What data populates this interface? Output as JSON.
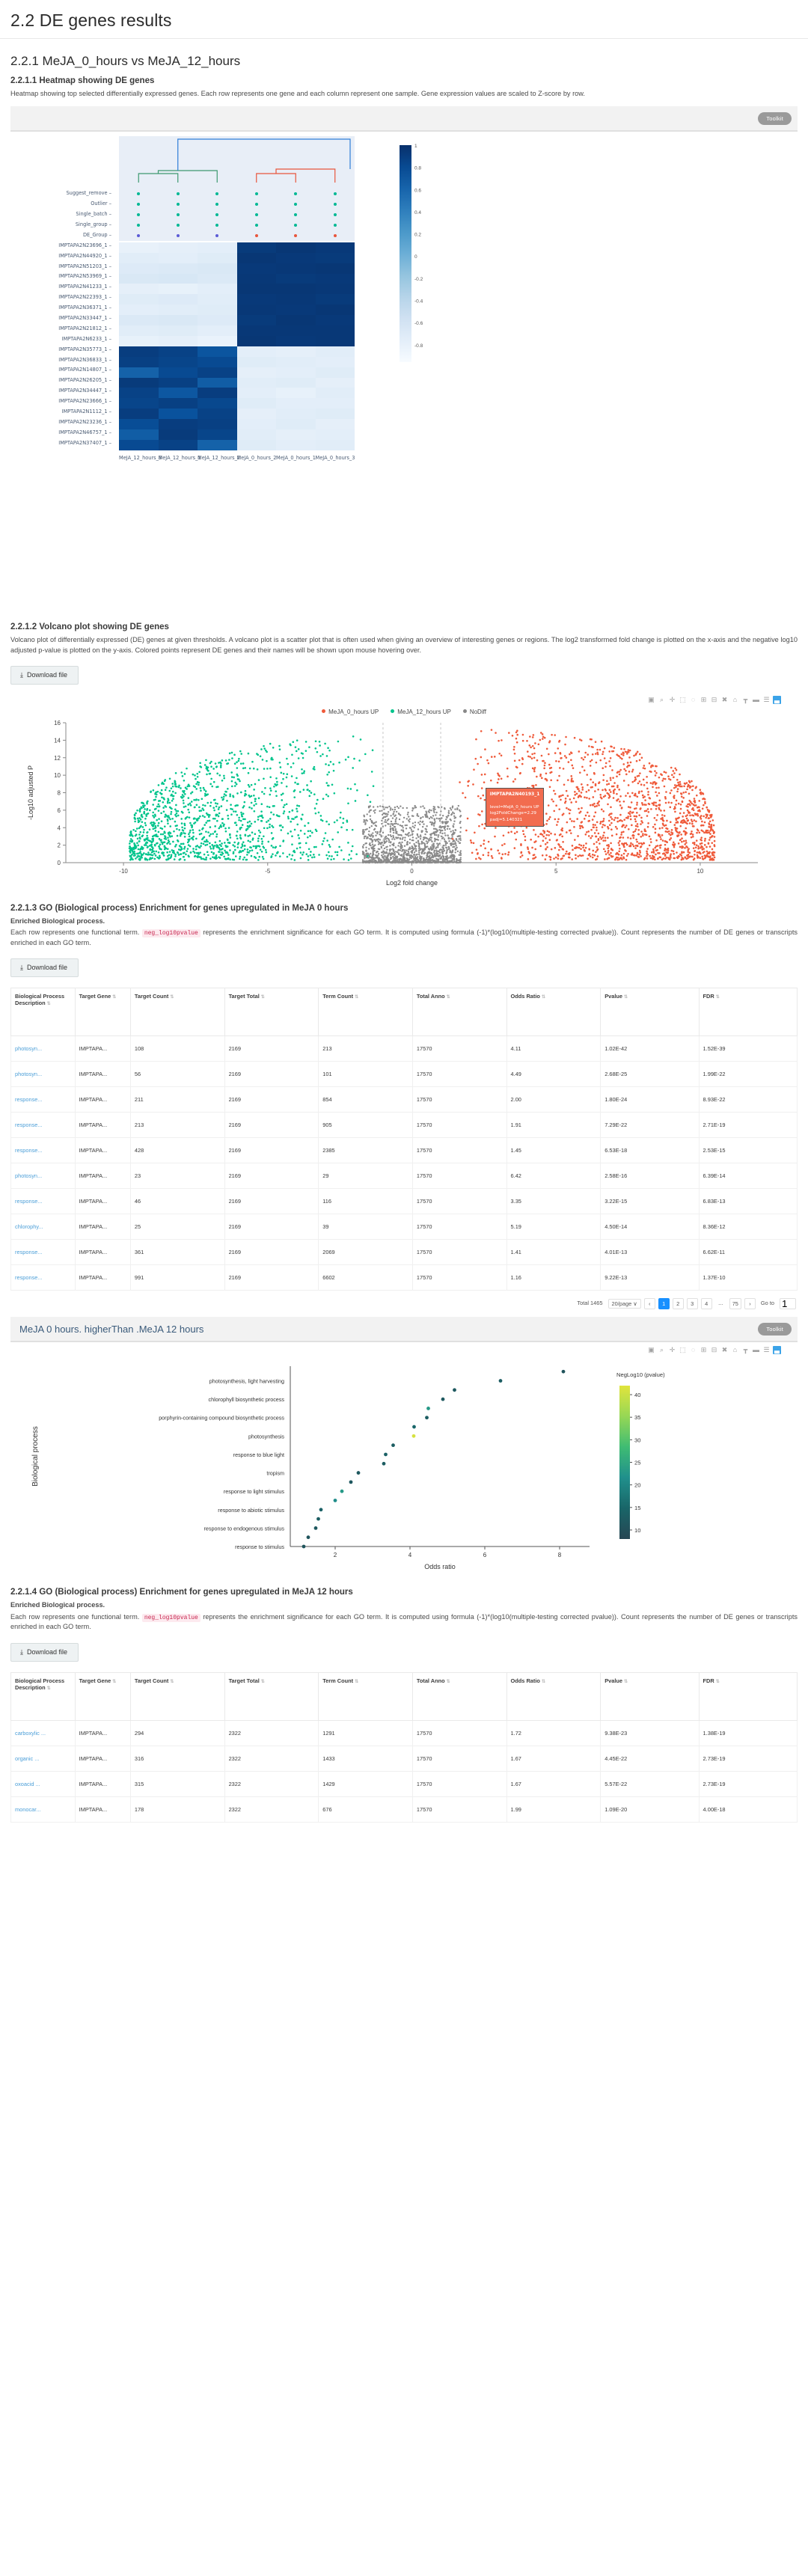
{
  "page_title": "2.2 DE genes results",
  "sections": {
    "comparison_heading": "2.2.1 MeJA_0_hours vs MeJA_12_hours",
    "heatmap": {
      "heading": "2.2.1.1 Heatmap showing DE genes",
      "description": "Heatmap showing top selected differentially expressed genes. Each row represents one gene and each column represent one sample. Gene expression values are scaled to Z-score by row.",
      "toolkit_label": "Toolkit",
      "annotation_rows": [
        "Suggest_remove",
        "Outlier",
        "Single_batch",
        "Single_group",
        "DE_Group"
      ],
      "gene_rows": [
        "IMPTAPA2N23696_1",
        "IMPTAPA2N44920_1",
        "IMPTAPA2N51203_1",
        "IMPTAPA2N53969_1",
        "IMPTAPA2N41233_1",
        "IMPTAPA2N22393_1",
        "IMPTAPA2N36371_1",
        "IMPTAPA2N33447_1",
        "IMPTAPA2N21812_1",
        "IMPTAPA2N6233_1",
        "IMPTAPA2N35773_1",
        "IMPTAPA2N36833_1",
        "IMPTAPA2N14807_1",
        "IMPTAPA2N26205_1",
        "IMPTAPA2N34447_1",
        "IMPTAPA2N23666_1",
        "IMPTAPA2N1112_1",
        "IMPTAPA2N23236_1",
        "IMPTAPA2N46757_1",
        "IMPTAPA2N37407_1"
      ],
      "sample_columns": [
        "MeJA_12_hours_3",
        "MeJA_12_hours_1",
        "MeJA_12_hours_2",
        "MeJA_0_hours_2",
        "MeJA_0_hours_1",
        "MeJA_0_hours_3"
      ],
      "colorbar_ticks": [
        "1",
        "0.8",
        "0.6",
        "0.4",
        "0.2",
        "0",
        "-0.2",
        "-0.4",
        "-0.6",
        "-0.8"
      ],
      "annotation_dot_colors": [
        "#00b894",
        "#00b894",
        "#00b894",
        "#00b894",
        "#5b5bd6"
      ],
      "de_group_colors": [
        "#5b5bd6",
        "#5b5bd6",
        "#5b5bd6",
        "#e8553c",
        "#e8553c",
        "#e8553c"
      ]
    },
    "volcano": {
      "heading": "2.2.1.2 Volcano plot showing DE genes",
      "description": "Volcano plot of differentially expressed (DE) genes at given thresholds. A volcano plot is a scatter plot that is often used when giving an overview of interesting genes or regions. The log2 transformed fold change is plotted on the x-axis and the negative log10 adjusted p-value is plotted on the y-axis. Colored points represent DE genes and their names will be shown upon mouse hovering over.",
      "download_label": "Download file",
      "legend": [
        {
          "label": "MeJA_0_hours UP",
          "color": "#ef5a3a"
        },
        {
          "label": "MeJA_12_hours UP",
          "color": "#00c48c"
        },
        {
          "label": "NoDiff",
          "color": "#888888"
        }
      ],
      "xlabel": "Log2 fold change",
      "ylabel": "-Log10 adjusted P",
      "xticks": [
        "-10",
        "-5",
        "0",
        "5",
        "10"
      ],
      "yticks": [
        "0",
        "2",
        "4",
        "6",
        "8",
        "10",
        "12",
        "14",
        "16"
      ],
      "tooltip": {
        "gene": "IMPTAPA2N40193_1",
        "line1": "level=MeJA_0_hours UP",
        "line2": "log2FoldChange=2.29",
        "line3": "padj=5.140321"
      }
    },
    "go_up_0h": {
      "heading": "2.2.1.3 GO (Biological process) Enrichment for genes upregulated in MeJA 0 hours",
      "desc_title": "Enriched Biological process.",
      "desc_pre": "Each row represents one functional term.",
      "desc_code": "neg_log10pvalue",
      "desc_post": "represents the enrichment significance for each GO term. It is computed using formula (-1)*(log10(multiple-testing corrected pvalue)). Count represents the number of DE genes or transcripts enriched in each GO term.",
      "download_label": "Download file",
      "columns": [
        "Biological Process Description",
        "Target Gene",
        "Target Count",
        "Target Total",
        "Term Count",
        "Total Anno",
        "Odds Ratio",
        "Pvalue",
        "FDR"
      ],
      "rows": [
        [
          "photosyn...",
          "IMPTAPA...",
          "108",
          "2169",
          "213",
          "17570",
          "4.11",
          "1.02E-42",
          "1.52E-39"
        ],
        [
          "photosyn...",
          "IMPTAPA...",
          "56",
          "2169",
          "101",
          "17570",
          "4.49",
          "2.68E-25",
          "1.99E-22"
        ],
        [
          "response...",
          "IMPTAPA...",
          "211",
          "2169",
          "854",
          "17570",
          "2.00",
          "1.80E-24",
          "8.93E-22"
        ],
        [
          "response...",
          "IMPTAPA...",
          "213",
          "2169",
          "905",
          "17570",
          "1.91",
          "7.29E-22",
          "2.71E-19"
        ],
        [
          "response...",
          "IMPTAPA...",
          "428",
          "2169",
          "2385",
          "17570",
          "1.45",
          "6.53E-18",
          "2.53E-15"
        ],
        [
          "photosyn...",
          "IMPTAPA...",
          "23",
          "2169",
          "29",
          "17570",
          "6.42",
          "2.58E-16",
          "6.39E-14"
        ],
        [
          "response...",
          "IMPTAPA...",
          "46",
          "2169",
          "116",
          "17570",
          "3.35",
          "3.22E-15",
          "6.83E-13"
        ],
        [
          "chlorophy...",
          "IMPTAPA...",
          "25",
          "2169",
          "39",
          "17570",
          "5.19",
          "4.50E-14",
          "8.36E-12"
        ],
        [
          "response...",
          "IMPTAPA...",
          "361",
          "2169",
          "2069",
          "17570",
          "1.41",
          "4.01E-13",
          "6.62E-11"
        ],
        [
          "response...",
          "IMPTAPA...",
          "991",
          "2169",
          "6602",
          "17570",
          "1.16",
          "9.22E-13",
          "1.37E-10"
        ]
      ],
      "pagination": {
        "total": "Total 1465",
        "page_size": "20/page",
        "prev": "‹",
        "pages": [
          "1",
          "2",
          "3",
          "4"
        ],
        "ellipsis": "...",
        "last": "75",
        "next": "›",
        "goto_label": "Go to",
        "goto_value": "1"
      }
    },
    "dotplot_0h": {
      "title": "MeJA 0 hours. higherThan .MeJA 12 hours",
      "toolkit_label": "Toolkit",
      "ylabel": "Biological process",
      "xlabel": "Odds ratio",
      "legend_title": "NegLog10 (pvalue)",
      "legend_ticks": [
        "40",
        "35",
        "30",
        "25",
        "20",
        "15",
        "10"
      ],
      "xticks": [
        "2",
        "4",
        "6",
        "8"
      ],
      "categories": [
        "photosynthesis, light harvesting",
        "chlorophyll biosynthetic process",
        "porphyrin-containing compound biosynthetic process",
        "photosynthesis",
        "response to blue light",
        "tropism",
        "response to light stimulus",
        "response to abiotic stimulus",
        "response to endogenous stimulus",
        "response to stimulus"
      ]
    },
    "go_up_12h": {
      "heading": "2.2.1.4 GO (Biological process) Enrichment for genes upregulated in MeJA 12 hours",
      "desc_title": "Enriched Biological process.",
      "desc_pre": "Each row represents one functional term.",
      "desc_code": "neg_log10pvalue",
      "desc_post": "represents the enrichment significance for each GO term. It is computed using formula (-1)*(log10(multiple-testing corrected pvalue)). Count represents the number of DE genes or transcripts enriched in each GO term.",
      "download_label": "Download file",
      "columns": [
        "Biological Process Description",
        "Target Gene",
        "Target Count",
        "Target Total",
        "Term Count",
        "Total Anno",
        "Odds Ratio",
        "Pvalue",
        "FDR"
      ],
      "rows": [
        [
          "carboxylic ...",
          "IMPTAPA...",
          "294",
          "2322",
          "1291",
          "17570",
          "1.72",
          "9.38E-23",
          "1.38E-19"
        ],
        [
          "organic ...",
          "IMPTAPA...",
          "316",
          "2322",
          "1433",
          "17570",
          "1.67",
          "4.45E-22",
          "2.73E-19"
        ],
        [
          "oxoacid ...",
          "IMPTAPA...",
          "315",
          "2322",
          "1429",
          "17570",
          "1.67",
          "5.57E-22",
          "2.73E-19"
        ],
        [
          "monocar...",
          "IMPTAPA...",
          "178",
          "2322",
          "676",
          "17570",
          "1.99",
          "1.09E-20",
          "4.00E-18"
        ]
      ]
    }
  },
  "chart_data": [
    {
      "type": "heatmap",
      "title": "Heatmap showing DE genes",
      "xlabel": "",
      "ylabel": "",
      "categories": [
        "MeJA_12_hours_3",
        "MeJA_12_hours_1",
        "MeJA_12_hours_2",
        "MeJA_0_hours_2",
        "MeJA_0_hours_1",
        "MeJA_0_hours_3"
      ],
      "rows": [
        "IMPTAPA2N23696_1",
        "IMPTAPA2N44920_1",
        "IMPTAPA2N51203_1",
        "IMPTAPA2N53969_1",
        "IMPTAPA2N41233_1",
        "IMPTAPA2N22393_1",
        "IMPTAPA2N36371_1",
        "IMPTAPA2N33447_1",
        "IMPTAPA2N21812_1",
        "IMPTAPA2N6233_1",
        "IMPTAPA2N35773_1",
        "IMPTAPA2N36833_1",
        "IMPTAPA2N14807_1",
        "IMPTAPA2N26205_1",
        "IMPTAPA2N34447_1",
        "IMPTAPA2N23666_1",
        "IMPTAPA2N1112_1",
        "IMPTAPA2N23236_1",
        "IMPTAPA2N46757_1",
        "IMPTAPA2N37407_1"
      ],
      "zlim": [
        -1,
        1
      ],
      "colorscale": "Blues",
      "values": [
        [
          -0.85,
          -0.82,
          -0.8,
          0.92,
          0.95,
          0.93
        ],
        [
          -0.78,
          -0.8,
          -0.76,
          0.95,
          0.93,
          0.92
        ],
        [
          -0.74,
          -0.72,
          -0.7,
          0.93,
          0.94,
          0.95
        ],
        [
          -0.7,
          -0.68,
          -0.72,
          0.94,
          0.92,
          0.93
        ],
        [
          -0.82,
          -0.84,
          -0.8,
          0.95,
          0.95,
          0.94
        ],
        [
          -0.76,
          -0.74,
          -0.78,
          0.93,
          0.94,
          0.92
        ],
        [
          -0.8,
          -0.78,
          -0.76,
          0.94,
          0.93,
          0.95
        ],
        [
          -0.72,
          -0.7,
          -0.74,
          0.92,
          0.95,
          0.93
        ],
        [
          -0.78,
          -0.76,
          -0.8,
          0.94,
          0.94,
          0.94
        ],
        [
          -0.84,
          -0.82,
          -0.86,
          0.95,
          0.93,
          0.94
        ],
        [
          0.9,
          0.86,
          0.72,
          -0.8,
          -0.82,
          -0.78
        ],
        [
          0.88,
          0.84,
          0.8,
          -0.76,
          -0.78,
          -0.8
        ],
        [
          0.62,
          0.8,
          0.86,
          -0.82,
          -0.8,
          -0.76
        ],
        [
          0.92,
          0.88,
          0.66,
          -0.78,
          -0.76,
          -0.82
        ],
        [
          0.86,
          0.7,
          0.9,
          -0.8,
          -0.84,
          -0.78
        ],
        [
          0.84,
          0.88,
          0.82,
          -0.76,
          -0.8,
          -0.8
        ],
        [
          0.9,
          0.74,
          0.86,
          -0.82,
          -0.78,
          -0.76
        ],
        [
          0.78,
          0.9,
          0.88,
          -0.8,
          -0.76,
          -0.82
        ],
        [
          0.66,
          0.92,
          0.84,
          -0.78,
          -0.82,
          -0.8
        ],
        [
          0.8,
          0.86,
          0.62,
          -0.76,
          -0.8,
          -0.78
        ]
      ]
    },
    {
      "type": "scatter",
      "title": "Volcano plot showing DE genes",
      "xlabel": "Log2 fold change",
      "ylabel": "-Log10 adjusted P",
      "xlim": [
        -12,
        12
      ],
      "ylim": [
        0,
        16
      ],
      "legend_position": "top",
      "series": [
        {
          "name": "MeJA_0_hours UP",
          "color": "#ef5a3a",
          "n_points": 2169
        },
        {
          "name": "MeJA_12_hours UP",
          "color": "#00c48c",
          "n_points": 2322
        },
        {
          "name": "NoDiff",
          "color": "#888888",
          "n_points": 13000
        }
      ]
    },
    {
      "type": "scatter",
      "title": "MeJA 0 hours. higherThan .MeJA 12 hours",
      "xlabel": "Odds ratio",
      "ylabel": "Biological process",
      "xlim": [
        0.8,
        8.8
      ],
      "legend_position": "right",
      "colorbar_label": "NegLog10 (pvalue)",
      "colorbar_range": [
        8,
        42
      ],
      "categories": [
        "photosynthesis, light harvesting",
        "chlorophyll biosynthetic process",
        "porphyrin-containing compound biosynthetic process",
        "photosynthesis",
        "response to blue light",
        "tropism",
        "response to light stimulus",
        "response to abiotic stimulus",
        "response to endogenous stimulus",
        "response to stimulus"
      ],
      "points": [
        {
          "x": 8.1,
          "y": 19,
          "c": 11
        },
        {
          "x": 6.42,
          "y": 18,
          "c": 13
        },
        {
          "x": 5.19,
          "y": 17,
          "c": 12
        },
        {
          "x": 4.88,
          "y": 16,
          "c": 12
        },
        {
          "x": 4.49,
          "y": 15,
          "c": 23
        },
        {
          "x": 4.45,
          "y": 14,
          "c": 13
        },
        {
          "x": 4.11,
          "y": 13,
          "c": 15
        },
        {
          "x": 4.1,
          "y": 12,
          "c": 41
        },
        {
          "x": 3.55,
          "y": 11,
          "c": 13
        },
        {
          "x": 3.35,
          "y": 10,
          "c": 14
        },
        {
          "x": 3.3,
          "y": 9,
          "c": 13
        },
        {
          "x": 2.62,
          "y": 8,
          "c": 12
        },
        {
          "x": 2.42,
          "y": 7,
          "c": 12
        },
        {
          "x": 2.18,
          "y": 6,
          "c": 23
        },
        {
          "x": 2.0,
          "y": 5,
          "c": 21
        },
        {
          "x": 1.62,
          "y": 4,
          "c": 14
        },
        {
          "x": 1.55,
          "y": 3,
          "c": 13
        },
        {
          "x": 1.48,
          "y": 2,
          "c": 12
        },
        {
          "x": 1.28,
          "y": 1,
          "c": 11
        },
        {
          "x": 1.16,
          "y": 0,
          "c": 11
        }
      ]
    }
  ]
}
